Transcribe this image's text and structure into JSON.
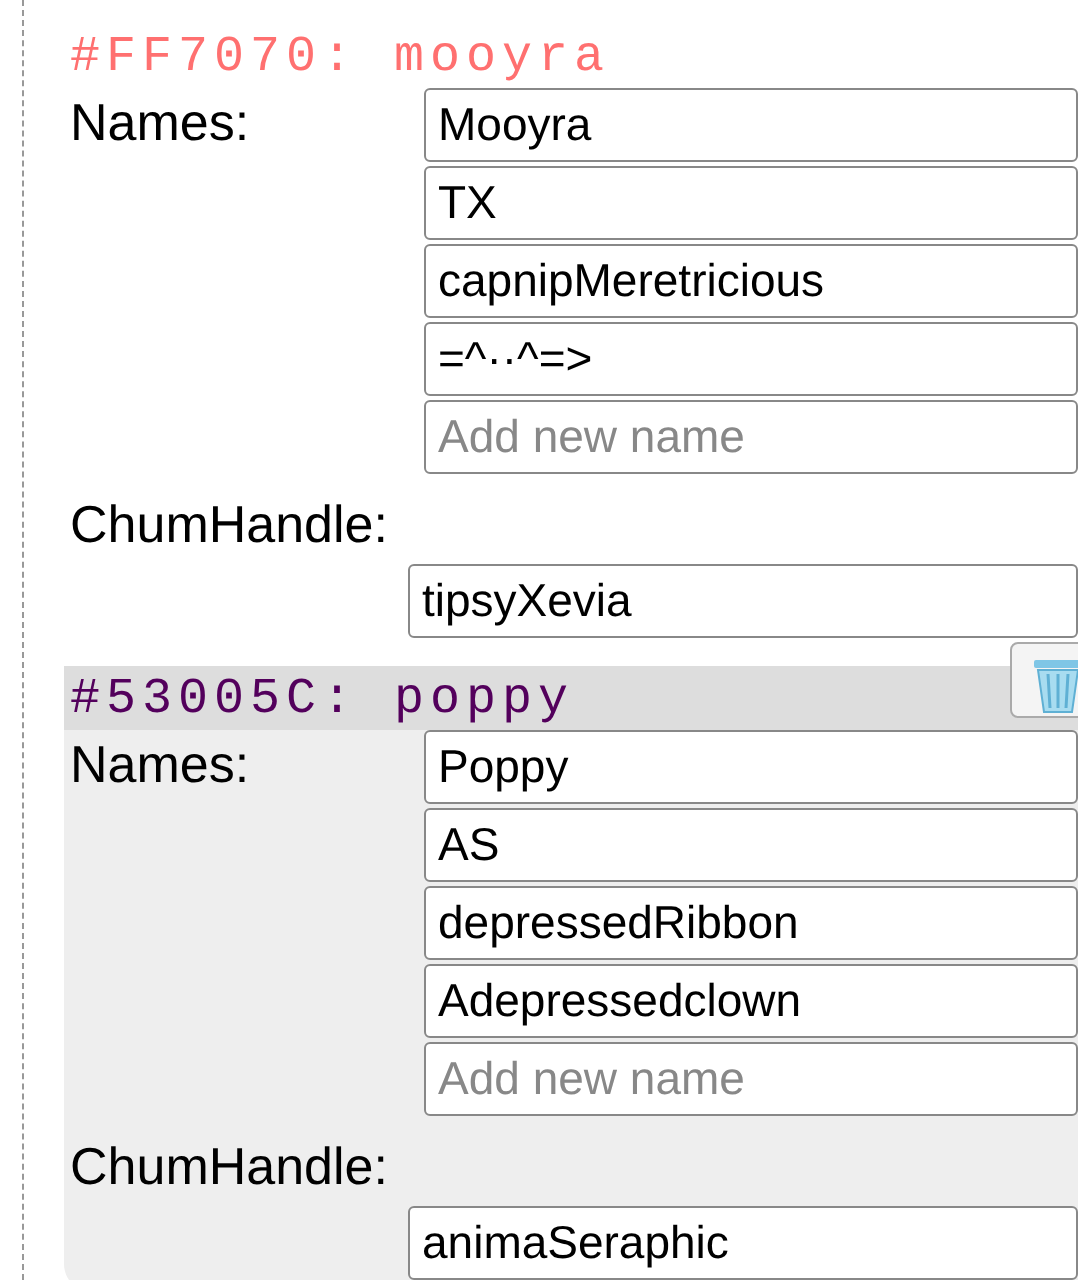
{
  "cards": [
    {
      "heading": "#FF7070: mooyra",
      "color": "#ff7070",
      "highlighted": false,
      "names_label": "Names:",
      "names": [
        "Mooyra",
        "TX",
        "capnipMeretricious",
        "=^··^=>"
      ],
      "new_name": {
        "placeholder": "Add new name"
      },
      "handle_label": "ChumHandle:",
      "handle": "tipsyXevia"
    },
    {
      "heading": "#53005C: poppy",
      "color": "#53005c",
      "highlighted": true,
      "names_label": "Names:",
      "names": [
        "Poppy",
        "AS",
        "depressedRibbon",
        "Adepressedclown"
      ],
      "new_name": {
        "placeholder": "Add new name"
      },
      "handle_label": "ChumHandle:",
      "handle": "animaSeraphic"
    }
  ]
}
